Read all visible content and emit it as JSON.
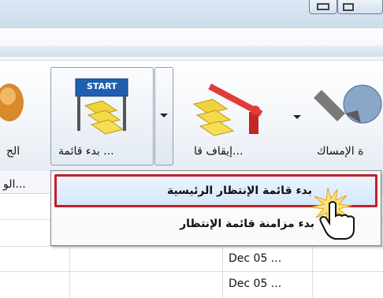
{
  "ribbon": {
    "item_left_label": "الج",
    "start_queue_label": "... بدء قائمة",
    "stop_queue_label": "...إيقاف قا",
    "hold_label": "ة الإمساك",
    "start_sign_text": "START"
  },
  "grid": {
    "header_cell": "...الو",
    "rows": [
      "Dec 05 ...",
      "Dec 05 ..."
    ]
  },
  "menu": {
    "items": [
      "بدء قائمة الإنتظار الرئيسية",
      "بدء مزامنة قائمة الإنتظار"
    ],
    "highlighted_index": 0
  },
  "colors": {
    "highlight_border": "#c0202a",
    "ribbon_border": "#8e9db0"
  }
}
